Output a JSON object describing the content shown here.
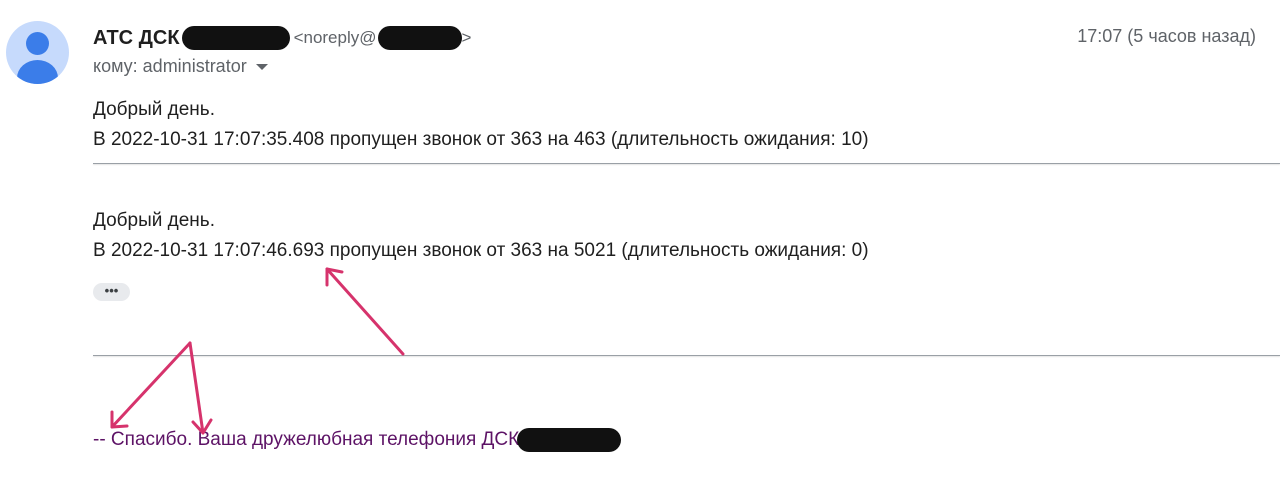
{
  "sender": {
    "name": "АТС ДСК",
    "email_prefix": "<noreply@",
    "email_suffix": ">"
  },
  "time": "17:07 (5 часов назад)",
  "recipient": {
    "label": "кому: administrator"
  },
  "messages": [
    {
      "greeting": "Добрый день.",
      "text": "В 2022-10-31 17:07:35.408 пропущен звонок от 363 на 463 (длительность ожидания: 10)"
    },
    {
      "greeting": "Добрый день.",
      "text": "В 2022-10-31 17:07:46.693 пропущен звонок от 363 на 5021 (длительность ожидания: 0)"
    }
  ],
  "more_button": "•••",
  "signature": "-- Спасибо. Ваша дружелюбная телефония ДСК",
  "colors": {
    "annotation_arrow": "#d6336c",
    "signature_text": "#5d1366",
    "avatar_bg": "#c6dafc",
    "avatar_fg": "#3b7de9"
  },
  "icons": {
    "avatar": "person-avatar-icon",
    "recipient_caret": "caret-down-icon",
    "more": "ellipsis-icon"
  }
}
